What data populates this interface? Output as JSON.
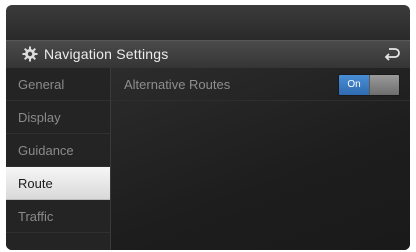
{
  "header": {
    "title": "Navigation Settings",
    "title_icon": "gear-icon",
    "back_icon": "back-arrow-icon"
  },
  "sidebar": {
    "items": [
      {
        "label": "General",
        "active": false
      },
      {
        "label": "Display",
        "active": false
      },
      {
        "label": "Guidance",
        "active": false
      },
      {
        "label": "Route",
        "active": true
      },
      {
        "label": "Traffic",
        "active": false
      }
    ]
  },
  "settings": {
    "alternative_routes": {
      "label": "Alternative Routes",
      "toggle_label": "On",
      "enabled": true
    }
  },
  "colors": {
    "accent": "#3a7cc4",
    "active_item_bg": "#e8e8e8"
  }
}
